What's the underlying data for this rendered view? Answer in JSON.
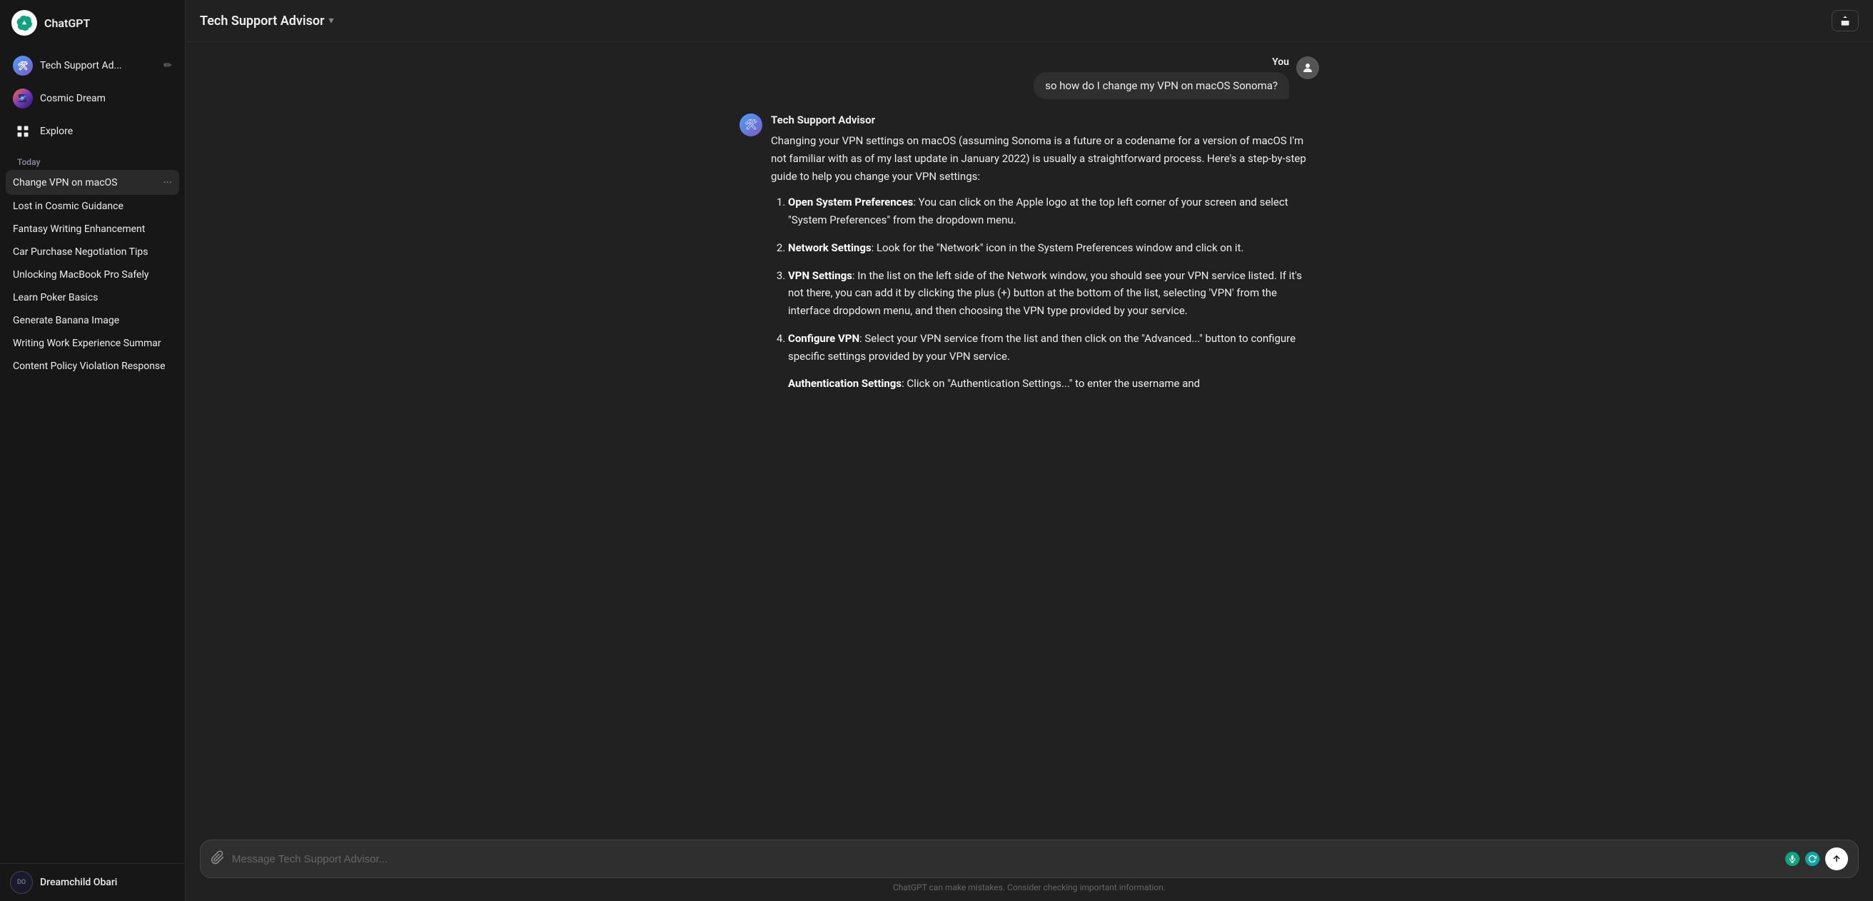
{
  "sidebar": {
    "app_name": "ChatGPT",
    "nav_items": [
      {
        "id": "tech-support",
        "label": "Tech Support Ad...",
        "type": "avatar-tech",
        "has_edit": true
      },
      {
        "id": "cosmic-dream",
        "label": "Cosmic Dream",
        "type": "avatar-cosmic",
        "has_edit": false
      }
    ],
    "explore_label": "Explore",
    "section_today": "Today",
    "conversations": [
      {
        "id": "change-vpn",
        "label": "Change VPN on macOS",
        "active": true
      },
      {
        "id": "cosmic-guidance",
        "label": "Lost in Cosmic Guidance"
      },
      {
        "id": "fantasy-writing",
        "label": "Fantasy Writing Enhancement"
      },
      {
        "id": "car-purchase",
        "label": "Car Purchase Negotiation Tips"
      },
      {
        "id": "macbook-pro",
        "label": "Unlocking MacBook Pro Safely"
      },
      {
        "id": "poker-basics",
        "label": "Learn Poker Basics"
      },
      {
        "id": "banana-image",
        "label": "Generate Banana Image"
      },
      {
        "id": "work-experience",
        "label": "Writing Work Experience Summar"
      },
      {
        "id": "content-policy",
        "label": "Content Policy Violation Response"
      }
    ],
    "user": {
      "name": "Dreamchild Obari",
      "avatar_text": "DO"
    }
  },
  "header": {
    "title": "Tech Support Advisor",
    "share_icon": "↑"
  },
  "messages": {
    "user_label": "You",
    "user_message": "so how do I change my VPN on macOS Sonoma?",
    "assistant_name": "Tech Support Advisor",
    "assistant_intro": "Changing your VPN settings on macOS (assuming Sonoma is a future or a codename for a version of macOS I'm not familiar with as of my last update in January 2022) is usually a straightforward process. Here's a step-by-step guide to help you change your VPN settings:",
    "steps": [
      {
        "title": "Open System Preferences",
        "content": ": You can click on the Apple logo at the top left corner of your screen and select \"System Preferences\" from the dropdown menu."
      },
      {
        "title": "Network Settings",
        "content": ": Look for the \"Network\" icon in the System Preferences window and click on it."
      },
      {
        "title": "VPN Settings",
        "content": ": In the list on the left side of the Network window, you should see your VPN service listed. If it's not there, you can add it by clicking the plus (+) button at the bottom of the list, selecting 'VPN' from the interface dropdown menu, and then choosing the VPN type provided by your service."
      },
      {
        "title": "Configure VPN",
        "content": ": Select your VPN service from the list and then click on the \"Advanced...\" button to configure specific settings provided by your VPN service."
      },
      {
        "title": "Authentication Settings",
        "content": ": Click on \"Authentication Settings...\" to enter the username and"
      }
    ]
  },
  "input": {
    "placeholder": "Message Tech Support Advisor...",
    "attach_icon": "📎",
    "send_icon": "↑"
  },
  "disclaimer": "ChatGPT can make mistakes. Consider checking important information."
}
